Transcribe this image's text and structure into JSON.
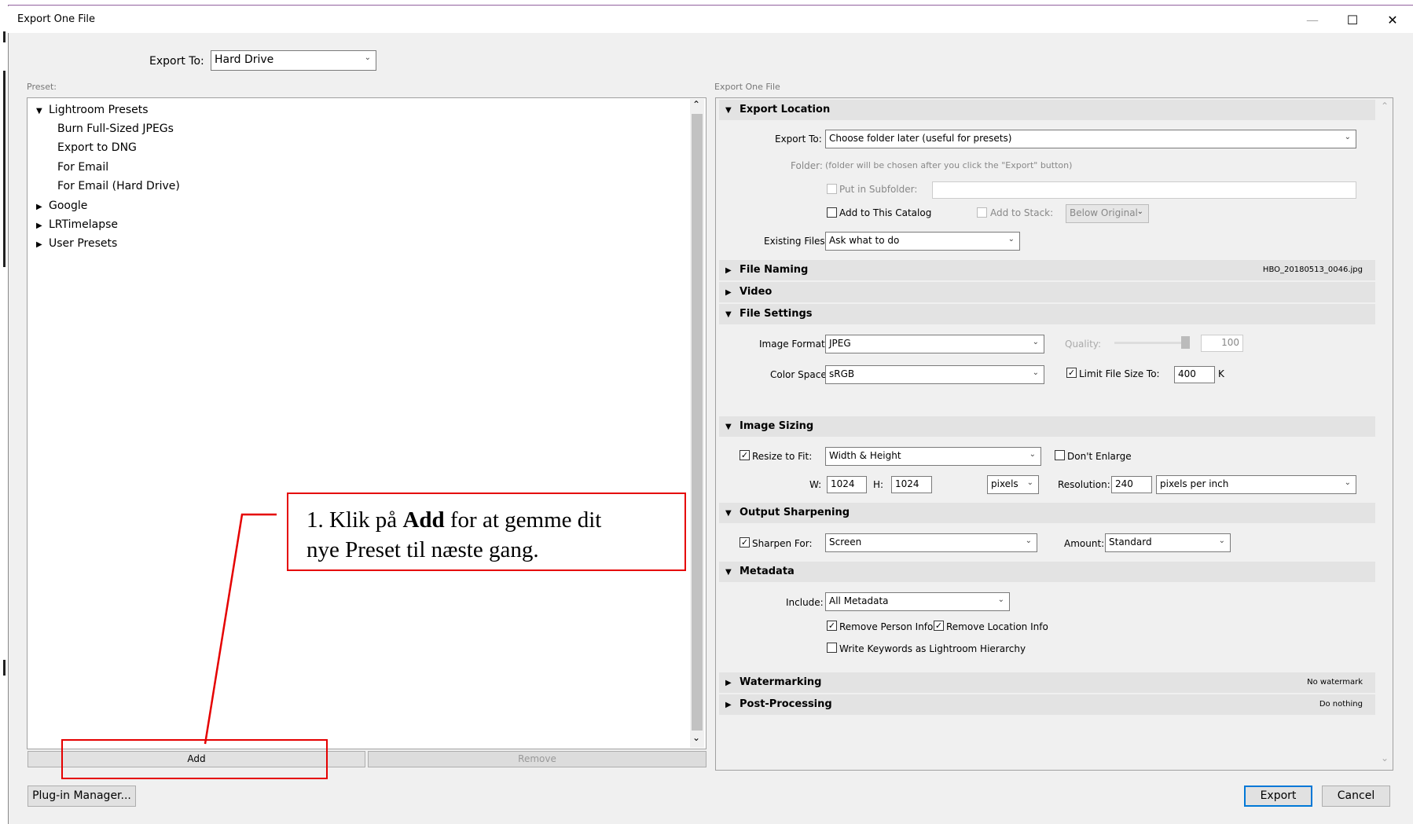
{
  "window": {
    "title": "Export One File"
  },
  "top": {
    "export_to_label": "Export To:",
    "export_to_value": "Hard Drive"
  },
  "preset": {
    "label": "Preset:",
    "root": "Lightroom Presets",
    "children": [
      "Burn Full-Sized JPEGs",
      "Export to DNG",
      "For Email",
      "For Email (Hard Drive)"
    ],
    "groups": [
      "Google",
      "LRTimelapse",
      "User Presets"
    ],
    "add_label": "Add",
    "remove_label": "Remove"
  },
  "settings_label": "Export One File",
  "export_location": {
    "title": "Export Location",
    "export_to_label": "Export To:",
    "export_to_value": "Choose folder later (useful for presets)",
    "folder_label": "Folder:",
    "folder_note": "(folder will be chosen after you click the \"Export\" button)",
    "put_in_subfolder": "Put in Subfolder:",
    "add_to_catalog": "Add to This Catalog",
    "add_to_stack": "Add to Stack:",
    "stack_value": "Below Original",
    "existing_label": "Existing Files:",
    "existing_value": "Ask what to do"
  },
  "file_naming": {
    "title": "File Naming",
    "value": "HBO_20180513_0046.jpg"
  },
  "video": {
    "title": "Video"
  },
  "file_settings": {
    "title": "File Settings",
    "format_label": "Image Format:",
    "format_value": "JPEG",
    "quality_label": "Quality:",
    "quality_value": "100",
    "quality_fraction": 1.0,
    "color_label": "Color Space:",
    "color_value": "sRGB",
    "limit_label": "Limit File Size To:",
    "limit_value": "400",
    "limit_unit": "K"
  },
  "image_sizing": {
    "title": "Image Sizing",
    "resize_label": "Resize to Fit:",
    "resize_value": "Width & Height",
    "dont_enlarge": "Don't Enlarge",
    "w_label": "W:",
    "w_value": "1024",
    "h_label": "H:",
    "h_value": "1024",
    "unit_value": "pixels",
    "res_label": "Resolution:",
    "res_value": "240",
    "res_unit": "pixels per inch"
  },
  "output_sharpening": {
    "title": "Output Sharpening",
    "sharpen_label": "Sharpen For:",
    "sharpen_value": "Screen",
    "amount_label": "Amount:",
    "amount_value": "Standard"
  },
  "metadata": {
    "title": "Metadata",
    "include_label": "Include:",
    "include_value": "All Metadata",
    "remove_person": "Remove Person Info",
    "remove_location": "Remove Location Info",
    "write_keywords": "Write Keywords as Lightroom Hierarchy"
  },
  "watermarking": {
    "title": "Watermarking",
    "value": "No watermark"
  },
  "post_processing": {
    "title": "Post-Processing",
    "value": "Do nothing"
  },
  "bottom": {
    "plugin_label": "Plug-in Manager...",
    "export_label": "Export",
    "cancel_label": "Cancel"
  },
  "callout": {
    "line1_pre": "1. Klik på ",
    "line1_bold": "Add",
    "line1_post": " for at gemme dit",
    "line2": "nye Preset til næste gang."
  },
  "colors": {
    "annotation_red": "#e50000",
    "section_header": "#e3e3e3",
    "default_button_border": "#0078d7"
  }
}
